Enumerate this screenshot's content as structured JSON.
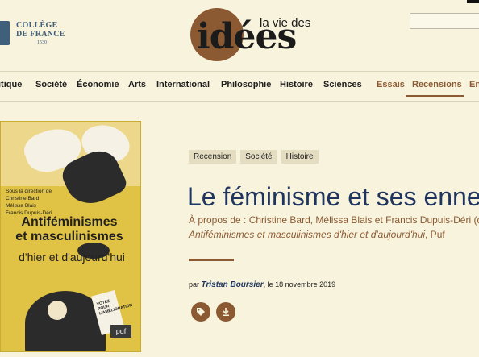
{
  "header": {
    "college_name_line1": "COLLÈGE",
    "college_name_line2": "DE FRANCE",
    "college_year": "1530",
    "brand_main": "idées",
    "brand_small": "la vie des",
    "search_placeholder": ""
  },
  "nav": {
    "items": [
      {
        "label": "itique",
        "accent": false
      },
      {
        "label": "Société",
        "accent": false
      },
      {
        "label": "Économie",
        "accent": false
      },
      {
        "label": "Arts",
        "accent": false
      },
      {
        "label": "International",
        "accent": false
      },
      {
        "label": "Philosophie",
        "accent": false
      },
      {
        "label": "Histoire",
        "accent": false
      },
      {
        "label": "Sciences",
        "accent": false
      },
      {
        "label": "Essais",
        "accent": true
      },
      {
        "label": "Recensions",
        "accent": true
      },
      {
        "label": "En",
        "accent": true
      }
    ],
    "active": "Recensions"
  },
  "cover": {
    "direction_line1": "Sous la direction de",
    "direction_line2": "Christine Bard",
    "direction_line3": "Mélissa Blais",
    "direction_line4": "Francis Dupuis-Déri",
    "title_line1": "Antiféminismes",
    "title_line2": "et masculinismes",
    "subtitle": "d'hier et d'aujourd'hui",
    "publisher": "puf",
    "poster_text": "VOTEZ POUR L'AMÉLIORATION"
  },
  "article": {
    "tags": [
      "Recension",
      "Société",
      "Histoire"
    ],
    "title": "Le féminisme et ses ennem",
    "apropos": "À propos de : Christine Bard, Mélissa Blais et Francis Dupuis-Déri (dir.),",
    "book_title": "Antiféminismes et masculinismes d'hier et d'aujourd'hui",
    "book_publisher": ", Puf",
    "by": "par",
    "author": "Tristan Boursier",
    "date": ", le 18 novembre 2019",
    "tag_icon": "tag-icon",
    "download_icon": "download-icon"
  },
  "colors": {
    "background": "#f8f3dc",
    "accent": "#8b5a33",
    "title_blue": "#1f3560"
  }
}
